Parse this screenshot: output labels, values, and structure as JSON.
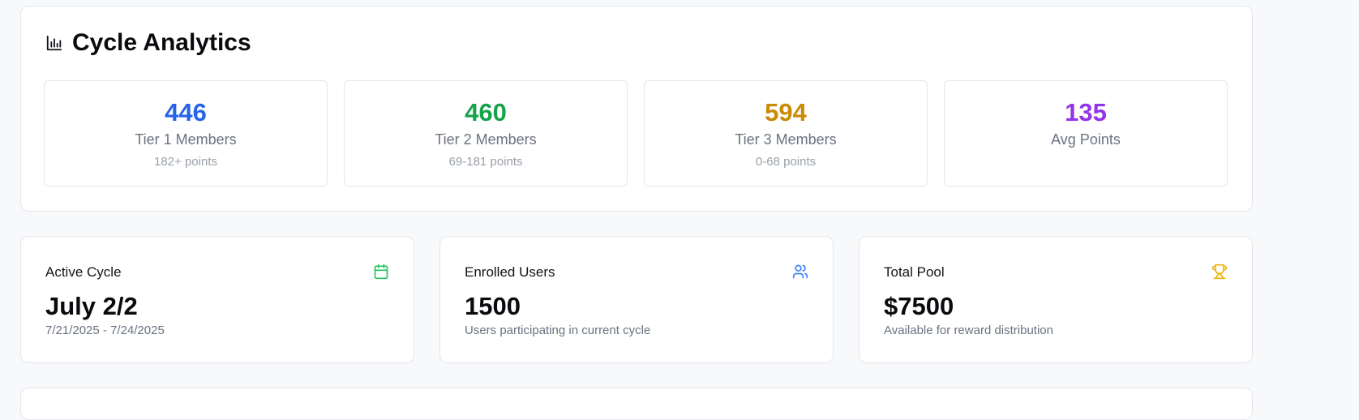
{
  "analytics": {
    "title": "Cycle Analytics",
    "tiers": [
      {
        "value": "446",
        "label": "Tier 1 Members",
        "sub": "182+ points",
        "color": "#2563eb"
      },
      {
        "value": "460",
        "label": "Tier 2 Members",
        "sub": "69-181 points",
        "color": "#16a34a"
      },
      {
        "value": "594",
        "label": "Tier 3 Members",
        "sub": "0-68 points",
        "color": "#ca8a04"
      },
      {
        "value": "135",
        "label": "Avg Points",
        "sub": "",
        "color": "#9333ea"
      }
    ]
  },
  "stats": [
    {
      "label": "Active Cycle",
      "value": "July 2/2",
      "desc": "7/21/2025 - 7/24/2025",
      "icon": "calendar-icon",
      "icon_color": "#22c55e"
    },
    {
      "label": "Enrolled Users",
      "value": "1500",
      "desc": "Users participating in current cycle",
      "icon": "users-icon",
      "icon_color": "#3b82f6"
    },
    {
      "label": "Total Pool",
      "value": "$7500",
      "desc": "Available for reward distribution",
      "icon": "trophy-icon",
      "icon_color": "#eab308"
    }
  ]
}
